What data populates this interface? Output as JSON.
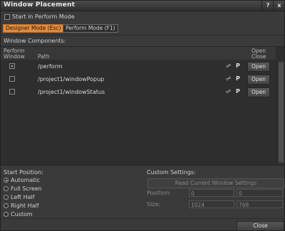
{
  "window": {
    "title": "Window Placement",
    "help_label": "?",
    "close_label": "x"
  },
  "start_in_perform": {
    "label": "Start in Perform Mode",
    "checked": false
  },
  "modes": {
    "designer_label": "Designer Mode (Esc)",
    "perform_label": "Perform Mode (F1)",
    "active": "designer"
  },
  "components": {
    "section_label": "Window Components:",
    "header_perform_line1": "Perform",
    "header_perform_line2": "Window",
    "header_path": "Path",
    "header_open_line1": "Open",
    "header_open_line2": "Close",
    "rows": [
      {
        "path": "/perform",
        "perform_checked": true,
        "p_label": "P",
        "open_label": "Open",
        "link_icon": "link-icon"
      },
      {
        "path": "/project1/windowPopup",
        "perform_checked": false,
        "p_label": "P",
        "open_label": "Open",
        "link_icon": "link-icon"
      },
      {
        "path": "/project1/windowStatus",
        "perform_checked": false,
        "p_label": "P",
        "open_label": "Open",
        "link_icon": "link-icon"
      }
    ]
  },
  "start_position": {
    "label": "Start Position:",
    "options": [
      "Automatic",
      "Full Screen",
      "Left Half",
      "Right Half",
      "Custom"
    ],
    "selected": "Automatic"
  },
  "custom_settings": {
    "label": "Custom Settings:",
    "read_button": "Read Current Window Settings",
    "position_label": "Position:",
    "position_x": "0",
    "position_y": "0",
    "size_label": "Size:",
    "size_w": "1024",
    "size_h": "768"
  },
  "footer": {
    "close_label": "Close"
  },
  "colors": {
    "accent": "#e38a3a",
    "background": "#3a3a3a",
    "panel": "#2e2e2e"
  }
}
